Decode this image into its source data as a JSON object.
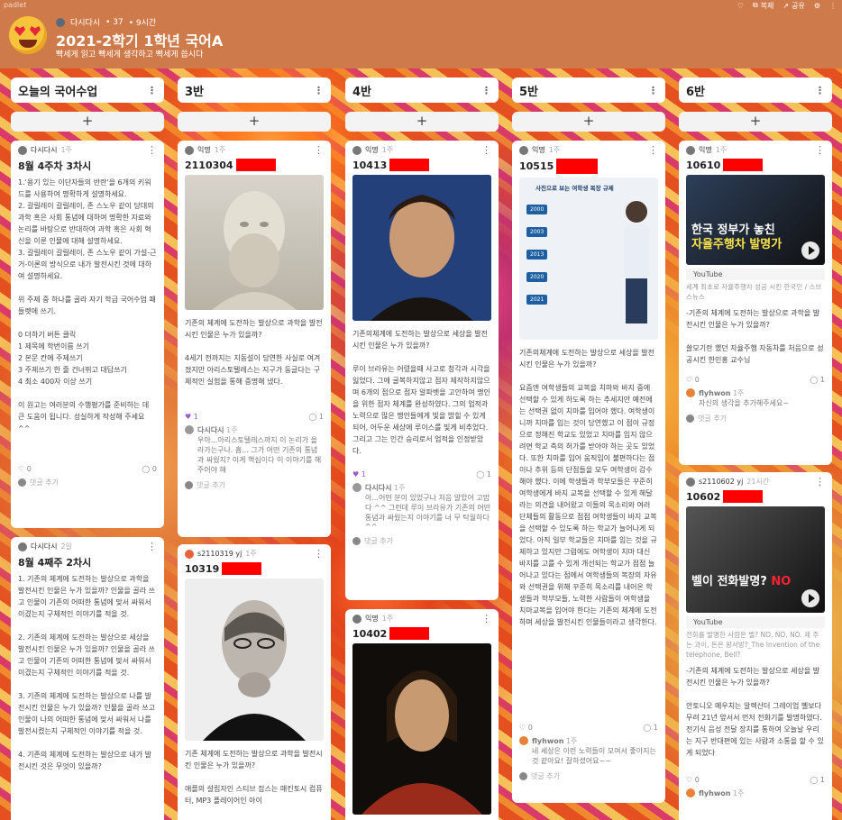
{
  "app": {
    "brand": "padlet",
    "actions": {
      "copy": "복제",
      "share": "공유"
    }
  },
  "board": {
    "author": "다시다시",
    "likes": "37",
    "time": "9시간",
    "title": "2021-2학기 1학년 국어A",
    "subtitle": "빡세게 읽고 빡세게 생각하고 빡세게 씁시다"
  },
  "columns": [
    {
      "title": "오늘의 국어수업",
      "add": "+"
    },
    {
      "title": "3반",
      "add": "+"
    },
    {
      "title": "4반",
      "add": "+"
    },
    {
      "title": "5반",
      "add": "+"
    },
    {
      "title": "6반",
      "add": "+"
    }
  ],
  "posts": {
    "c0p0": {
      "author": "다시다시",
      "time": "1주",
      "title": "8월 4주차 3차시",
      "body": "1.'용기 있는 이단자들의 반란'을 6개의 키워드를 사용하여 명확하게 설명하세요.\n2. 갈릴레이 갈릴레이, 존 스노우 같이 당대의 과학 혹은 사회 통념에 대하여 명확한 자료와 논리를 바탕으로 반대하여 과학 혹은 사회 혁신을 이룬 인물에 대해 설명하세요.\n3. 갈릴레이 갈릴레이, 존 스노우 같이 가설-근거-이론의 방식으로 내가 발전시킨 것에 대하여 설명하세요.\n\n위 주제 중 하나를 골라 자기 학급 국어수업 패들렛에 쓰기.\n\n0 더하기 버튼 클릭\n1 제목에 학번이름 쓰기\n2 본문 칸에 주제쓰기\n3 주제쓰기 한 줄 건너뛰고 대답쓰기\n4 최소 400자 이상 쓰기\n\n이 원고는 여러분의 수행평가를 준비하는 데 큰 도움이 됩니다. 성실하게 작성해 주세요 ^^",
      "likes": "0",
      "comments": "0",
      "addComment": "댓글 추가"
    },
    "c0p1": {
      "author": "다시다시",
      "time": "2일",
      "title": "8월 4째주 2차시",
      "body": "1. 기존의 체계에 도전하는 발상으로 과학을 발전시킨 인물은 누가 있을까? 인물을 골라 쓰고 인물이 기존의 어떠한 통념에 맞서 싸워서 이겼는지 구체적인 이야기를 적을 것.\n\n2. 기존의 체계에 도전하는 발상으로 세상을 발전시킨 인물은 누가 있을까? 인물을 골라 쓰고 인물이 기존의 어떠한 통념에 맞서 싸워서 이겼는지 구체적인 이야기를 적을 것.\n\n3. 기존의 체계에 도전하는 발상으로 나를 발전시킨 인물은 누가 있을까? 인물을 골라 쓰고 인물이 나의 어떠한 통념에 맞서 싸워서 나를 발전시켰는지 구체적인 이야기를 적을 것.\n\n4. 기존의 체계에 도전하는 발상으로 내가 발전시킨 것은 무엇이 있을까?"
    },
    "c1p0": {
      "author": "익명",
      "time": "1주",
      "title": "2110304",
      "body": "기존의 체계에 도전하는 발상으로 과학을 발전시킨 인물은 누가 있을까?\n\n4세기 전까지는 지동설이 당연한 사실로 여겨졌지만 아리스토텔레스는 지구가 둥글다는 구체적인 실험을 통해 증명해 냈다.",
      "likes": "1",
      "comments": "1",
      "commentAuthor": "다시다시",
      "commentTime": "1주",
      "commentText": "우아...아리스토텔레스까지 이 논리가 올라가는구나. 흠... 그가 어떤 기존의 통념과 싸웠지? 이게 핵심이다 이 이야기를 해 주어야 해",
      "addComment": "댓글 추가"
    },
    "c1p1": {
      "author": "s2110319 yj",
      "time": "1주",
      "title": "10319",
      "body": "기존 체계에 도전하는 발상으로 과학을 발전시킨 인물은 누가 있을까?\n\n애플의 설립자인 스티브 잡스는 매킨토시 컴퓨터, MP3 플레이어인 아이"
    },
    "c2p0": {
      "author": "익명",
      "time": "1주",
      "title": "10413",
      "body": "기존의체계에 도전하는 발상으로 세상을 발전시킨 인물은 누가 있을까?\n\n루이 브라유는 어렸을때 사고로 청각과 시각을 잃었다. 그에 굴복하지않고 점자 제작하지않으며 6개의 점으로 점자 알파벳을 고안하여 맹인을 위한 점자 체계를 완성하였다. 그의 업적과 노력으로 많은 맹인들에게 빛을 밝힐 수 있게되어, 어두운 세상에 루이스를 빛게 비추었다. 그리고 그는 인간 승리로서 업적을 인정받았다.",
      "likes": "1",
      "comments": "1",
      "commentAuthor": "다시다시",
      "commentTime": "1주",
      "commentText": "아...어떤 분이 있었구나 처음 알았어 고맙다 ^^ 그런데 루이 브라유가 기존의 어떤 통념과 싸웠는지 이야기를 너 무 탁월하다 ^^",
      "addComment": "댓글 추가"
    },
    "c2p1": {
      "author": "익명",
      "time": "1주",
      "title": "10402"
    },
    "c3p0": {
      "author": "익명",
      "time": "1주",
      "title": "10515",
      "body": "기존의체계에 도전하는 발상으로 세상을 발전시킨 인물은 누가 있을까?\n\n요즘엔 여학생들의 교복을 치마와 바지 중에 선택할 수 있게 하도록 하는 추세지만 예전에는 선택권 없이 치마를 입어야 했다. 여학생이니까 치마를 입는 것이 당연했고 이 점이 규정으로 정해진 학교도 있었고 치마를 입지 않으려면 학교 측의 허가를 받아야 하는 곳도 있었다. 또한 치마를 입어 움직임이 불편하다는 점이나 추위 등의 단점들을 모두 여학생이 감수해야 했다. 이에 학생들과 학부모들은 꾸준히 여학생에게 바지 교복을 선택할 수 있게 해달라는 의견을 내어왔고 이들의 목소리와 여러 단체들의 활동으로 점점 여학생들이 바지 교복을 선택할 수 있도록 하는 학교가 늘어나게 되었다. 아직 일부 학교들은 치마를 입는 것을 규제하고 있지만 그럼에도 여학생이 치마 대신 바지를 고를 수 있게 개선되는 학교가 점점 늘어나고 있다는 점에서 여학생들의 복장의 자유와 선택권을 위해 꾸준히 목소리를 내어온 학생들과 학부모들, 노력한 사람들이 여학생을 치마교복을 입어야 한다는 기존의 체계에 도전하며 세상을 발전시킨 인물들이라고 생각한다.",
      "likes": "0",
      "comments": "1",
      "commentAuthor": "flyhwon",
      "commentTime": "1주",
      "commentText": "네 세상은 이런 노력들이 모여서 좋아지는 것 같아요! 잘하셨어요~~",
      "addComment": "댓글 추가",
      "imgText": "사진으로 보는 여학생 복장 규제",
      "years": [
        "2000",
        "2003",
        "2013",
        "2020",
        "2021"
      ]
    },
    "c4p0": {
      "author": "익명",
      "time": "1주",
      "title": "10610",
      "ytCap1": "한국 정부가 놓친",
      "ytCap2": "자율주행차 발명가",
      "ytLabel": "YouTube",
      "linkDesc": "세계 최초로 자율주행차 성공 시킨 한국인 / 스브스뉴스",
      "body": "-기존의 체계에 도전하는 발상으로 과학을 발전시킨 인물은 누가 있을까?\n\n쓸모기란 했던 자율주행 자동차를 처음으로 성공시킨 한민홍 교수님",
      "likes": "0",
      "comments": "1",
      "commentAuthor": "flyhwon",
      "commentTime": "1주",
      "commentText": "자신의 생각을 추가해주세요~",
      "addComment": "댓글 추가"
    },
    "c4p1": {
      "author": "s2110602 yj",
      "time": "21시간",
      "title": "10602",
      "ytCap1": "벨이 전화발명?",
      "ytCap2": "NO",
      "ytLabel": "YouTube",
      "linkDesc": "전화를 발명한 사람은 벨? NO, NO, NO. 제 주는 과이, 돈은 왕서방?_The Invention of the telephone, Bell?",
      "body": "-기존의 체계에 도전하는 발상으로 세상을 발전시킨 인물은 누가 있을까?\n\n안토니오 메우치는 알렉산더 그레이엄 벨보다 무려 21년 앞서서 먼저 전화기를 발명하였다. 전기식 음성 전달 장치를 통하여 오늘날 우리는 지구 반대편에 있는 사람과 소통을 할 수 있게 되었다",
      "likes": "0",
      "comments": "1",
      "commentAuthor": "flyhwon",
      "commentTime": "1주"
    }
  },
  "colors": {
    "topbar": "#cf7a4a",
    "card": "#ffffff",
    "redact": "#ff0000",
    "accent": "#9b59d0"
  }
}
